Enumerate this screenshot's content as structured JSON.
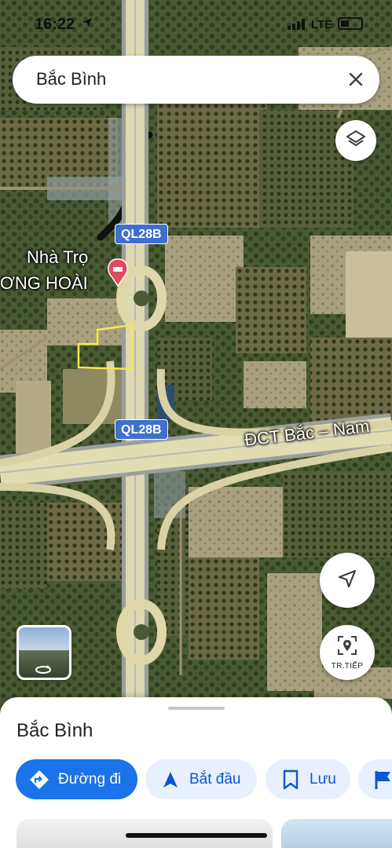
{
  "status_bar": {
    "time": "16:22",
    "network": "LTE"
  },
  "search": {
    "query": "Bắc Bình"
  },
  "map": {
    "route_labels": [
      "QL28B",
      "QL28B"
    ],
    "place_name_line1": "Nhà Trọ",
    "place_name_line2": "ƠNG HOÀI",
    "expressway_label": "ĐCT Bắc – Nam",
    "highlight_color": "#f5e94b",
    "route_color": "#3f6fcf",
    "accent_color": "#1a73e8"
  },
  "controls": {
    "layers_icon": "layers-icon",
    "navigate_icon": "navigation-arrow-icon",
    "live_view_label": "TR.TIẾP"
  },
  "sheet": {
    "title": "Bắc Bình",
    "actions": [
      {
        "label": "Đường đi",
        "icon": "directions-icon"
      },
      {
        "label": "Bắt đầu",
        "icon": "start-arrow-icon"
      },
      {
        "label": "Lưu",
        "icon": "bookmark-icon"
      },
      {
        "label": "",
        "icon": "flag-icon"
      }
    ]
  }
}
